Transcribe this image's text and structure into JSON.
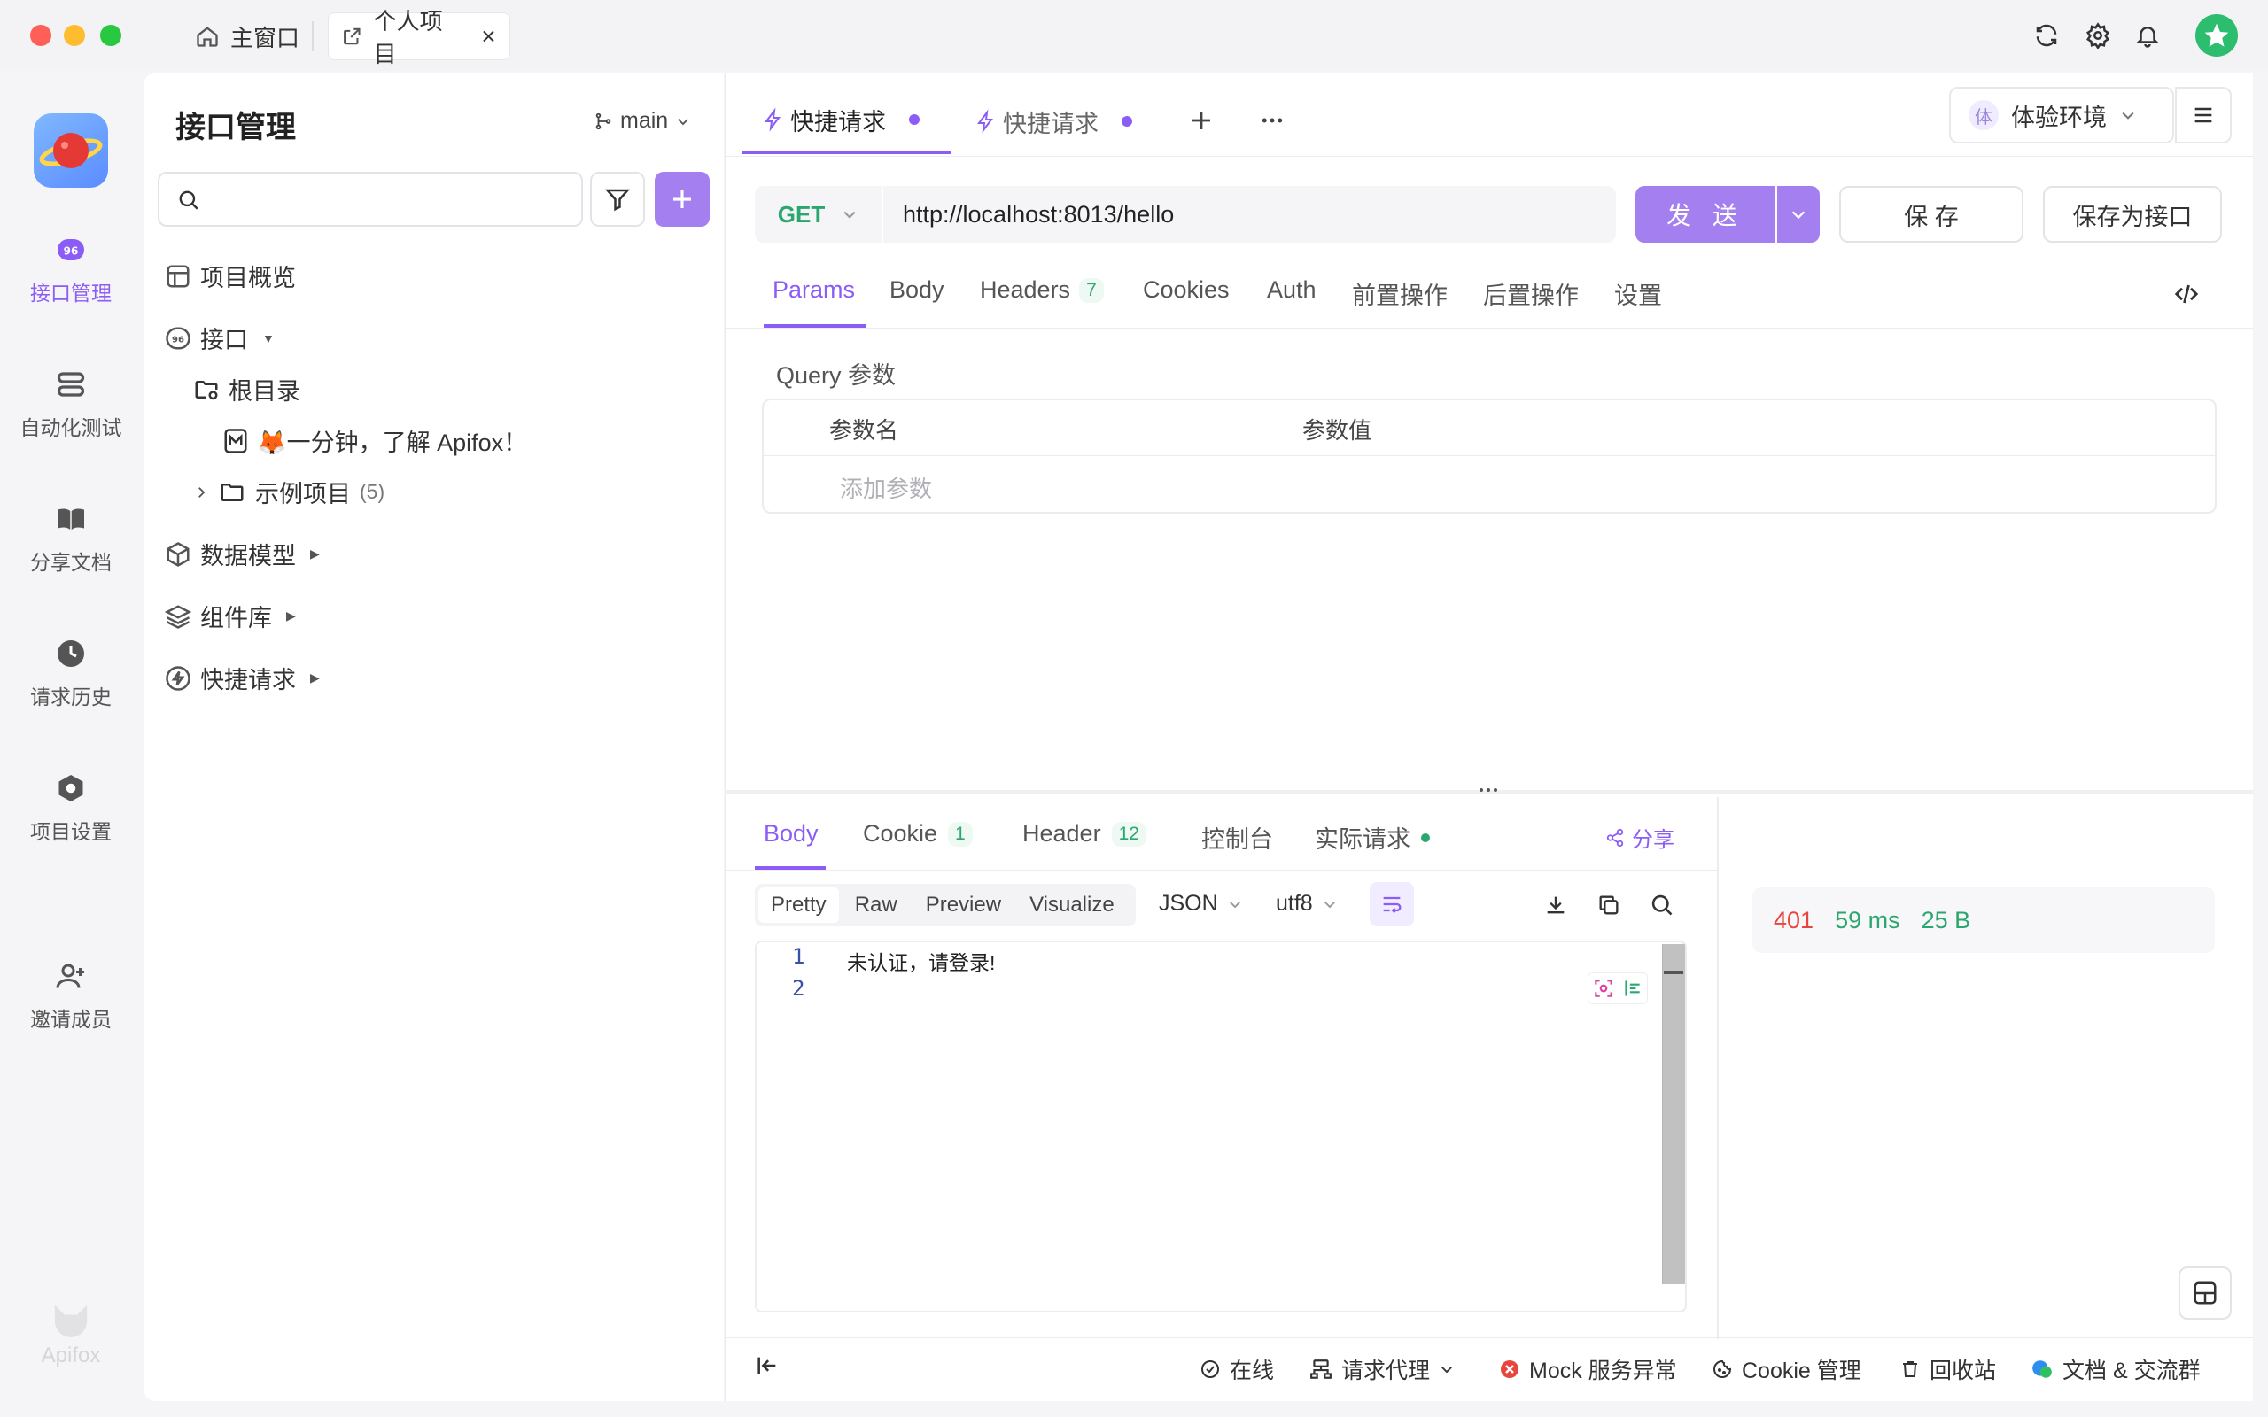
{
  "window": {
    "tabs": [
      {
        "label": "主窗口"
      },
      {
        "label": "个人项目"
      }
    ]
  },
  "rail": {
    "items": [
      {
        "label": "接口管理"
      },
      {
        "label": "自动化测试"
      },
      {
        "label": "分享文档"
      },
      {
        "label": "请求历史"
      },
      {
        "label": "项目设置"
      },
      {
        "label": "邀请成员"
      }
    ],
    "brand": "Apifox"
  },
  "tree": {
    "title": "接口管理",
    "branch": "main",
    "search_placeholder": "",
    "items": [
      {
        "label": "项目概览"
      },
      {
        "label": "接口"
      },
      {
        "label": "根目录"
      },
      {
        "label": "🦊一分钟，了解 Apifox！"
      },
      {
        "label": "示例项目",
        "count": "(5)"
      },
      {
        "label": "数据模型"
      },
      {
        "label": "组件库"
      },
      {
        "label": "快捷请求"
      }
    ]
  },
  "request_tabs": [
    {
      "label": "快捷请求"
    },
    {
      "label": "快捷请求"
    }
  ],
  "environment": {
    "badge": "体",
    "label": "体验环境"
  },
  "request": {
    "method": "GET",
    "url": "http://localhost:8013/hello",
    "send_label": "发 送",
    "save_label": "保 存",
    "save_as_label": "保存为接口"
  },
  "param_tabs": [
    {
      "label": "Params"
    },
    {
      "label": "Body"
    },
    {
      "label": "Headers",
      "badge": "7"
    },
    {
      "label": "Cookies"
    },
    {
      "label": "Auth"
    },
    {
      "label": "前置操作"
    },
    {
      "label": "后置操作"
    },
    {
      "label": "设置"
    }
  ],
  "query": {
    "title": "Query 参数",
    "col_name": "参数名",
    "col_value": "参数值",
    "add_placeholder": "添加参数"
  },
  "response": {
    "tabs": [
      {
        "label": "Body"
      },
      {
        "label": "Cookie",
        "badge": "1"
      },
      {
        "label": "Header",
        "badge": "12"
      },
      {
        "label": "控制台"
      },
      {
        "label": "实际请求"
      }
    ],
    "share_label": "分享",
    "formats": [
      "Pretty",
      "Raw",
      "Preview",
      "Visualize"
    ],
    "format_type": "JSON",
    "encoding": "utf8",
    "lines": [
      {
        "num": "1",
        "text": "未认证，请登录!"
      },
      {
        "num": "2",
        "text": ""
      }
    ],
    "status": {
      "code": "401",
      "time": "59 ms",
      "size": "25 B"
    },
    "colors": {
      "error": "#e8453c",
      "ok": "#2aa66f",
      "accent": "#8b5cf6"
    }
  },
  "footer": {
    "online": "在线",
    "proxy": "请求代理",
    "mock": "Mock 服务异常",
    "cookie": "Cookie 管理",
    "trash": "回收站",
    "docs": "文档 & 交流群"
  }
}
